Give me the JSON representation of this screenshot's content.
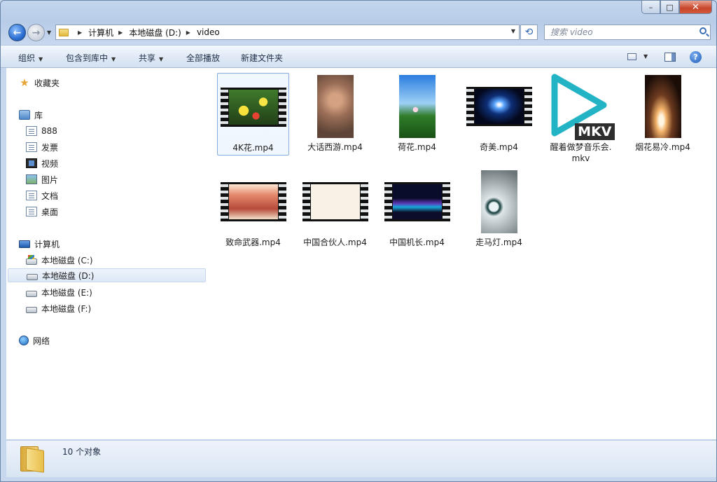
{
  "window": {
    "caption": {
      "minimize": "–",
      "maximize": "□",
      "close": "✕"
    }
  },
  "address": {
    "crumbs": [
      "计算机",
      "本地磁盘 (D:)",
      "video"
    ],
    "search_placeholder": "搜索 video"
  },
  "toolbar": {
    "organize": "组织",
    "include_in_library": "包含到库中",
    "share": "共享",
    "play_all": "全部播放",
    "new_folder": "新建文件夹"
  },
  "nav": {
    "favorites": "收藏夹",
    "libraries": "库",
    "library_items": [
      "888",
      "发票",
      "视频",
      "图片",
      "文档",
      "桌面"
    ],
    "computer": "计算机",
    "drives": [
      "本地磁盘 (C:)",
      "本地磁盘 (D:)",
      "本地磁盘 (E:)",
      "本地磁盘 (F:)"
    ],
    "selected_drive_index": 1,
    "network": "网络"
  },
  "files": [
    {
      "name": "4K花.mp4",
      "kind": "film-landscape",
      "selected": true
    },
    {
      "name": "大话西游.mp4",
      "kind": "portrait"
    },
    {
      "name": "荷花.mp4",
      "kind": "portrait"
    },
    {
      "name": "奇美.mp4",
      "kind": "film-landscape"
    },
    {
      "name": "醒着做梦音乐会.mkv",
      "kind": "mkv-icon"
    },
    {
      "name": "烟花易冷.mp4",
      "kind": "portrait"
    },
    {
      "name": "致命武器.mp4",
      "kind": "film-landscape"
    },
    {
      "name": "中国合伙人.mp4",
      "kind": "film-landscape"
    },
    {
      "name": "中国机长.mp4",
      "kind": "film-landscape"
    },
    {
      "name": "走马灯.mp4",
      "kind": "portrait"
    }
  ],
  "mkv_badge": "MKV",
  "status": {
    "count_text": "10 个对象"
  },
  "colors": {
    "accent": "#2f6fc9",
    "mkv_play": "#22b3c4",
    "selection_border": "#84acdd"
  }
}
